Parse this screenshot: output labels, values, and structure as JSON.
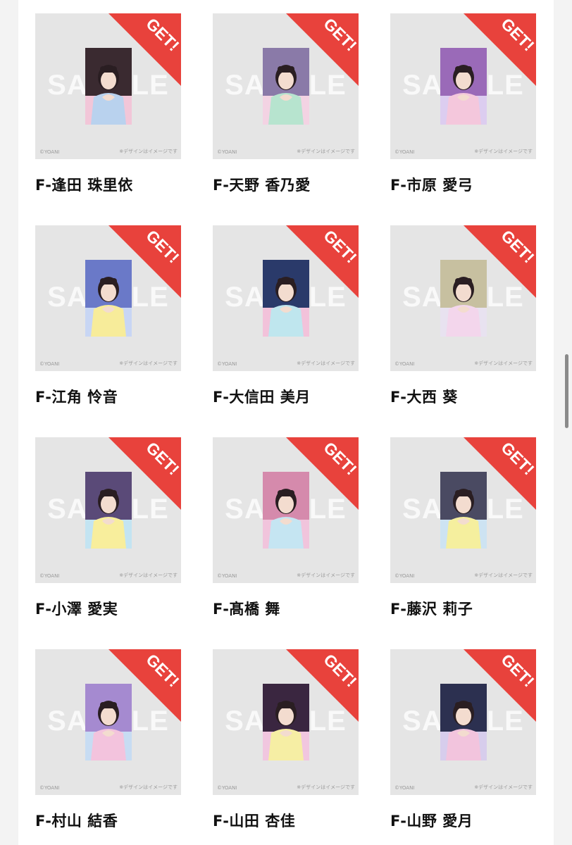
{
  "colors": {
    "ribbon": "#e8423c",
    "card_background": "#e5e5e5",
    "page_background": "#f3f3f3"
  },
  "cards": [
    {
      "name": "F-逢田 珠里依",
      "badge": "GET!",
      "watermark": "SAMPLE",
      "copyright": "©YOANI",
      "note": "※デザインはイメージです",
      "palette": [
        "#3a2a30",
        "#b9d2ee",
        "#f2c6d8"
      ]
    },
    {
      "name": "F-天野 香乃愛",
      "badge": "GET!",
      "watermark": "SAMPLE",
      "copyright": "©YOANI",
      "note": "※デザインはイメージです",
      "palette": [
        "#8a7aa8",
        "#b7e4cf",
        "#f3d3e3"
      ]
    },
    {
      "name": "F-市原 愛弓",
      "badge": "GET!",
      "watermark": "SAMPLE",
      "copyright": "©YOANI",
      "note": "※デザインはイメージです",
      "palette": [
        "#9a6ab8",
        "#f4c7dc",
        "#dccdf0"
      ]
    },
    {
      "name": "F-江角 怜音",
      "badge": "GET!",
      "watermark": "SAMPLE",
      "copyright": "©YOANI",
      "note": "※デザインはイメージです",
      "palette": [
        "#6a79c8",
        "#f7ec9a",
        "#c8d6f4"
      ]
    },
    {
      "name": "F-大信田 美月",
      "badge": "GET!",
      "watermark": "SAMPLE",
      "copyright": "©YOANI",
      "note": "※デザインはイメージです",
      "palette": [
        "#2a3a6a",
        "#bfe6ee",
        "#f2c2da"
      ]
    },
    {
      "name": "F-大西 葵",
      "badge": "GET!",
      "watermark": "SAMPLE",
      "copyright": "©YOANI",
      "note": "※デザインはイメージです",
      "palette": [
        "#c7c0a0",
        "#f3d6ec",
        "#e8e2f0"
      ]
    },
    {
      "name": "F-小澤 愛実",
      "badge": "GET!",
      "watermark": "SAMPLE",
      "copyright": "©YOANI",
      "note": "※デザインはイメージです",
      "palette": [
        "#5a4a78",
        "#f8ee9c",
        "#c3e4f2"
      ]
    },
    {
      "name": "F-髙橋 舞",
      "badge": "GET!",
      "watermark": "SAMPLE",
      "copyright": "©YOANI",
      "note": "※デザインはイメージです",
      "palette": [
        "#d58aac",
        "#c5e5f2",
        "#f1c4dc"
      ]
    },
    {
      "name": "F-藤沢 莉子",
      "badge": "GET!",
      "watermark": "SAMPLE",
      "copyright": "©YOANI",
      "note": "※デザインはイメージです",
      "palette": [
        "#4a4a62",
        "#f5ef9e",
        "#cde3f2"
      ]
    },
    {
      "name": "F-村山 結香",
      "badge": "GET!",
      "watermark": "SAMPLE",
      "copyright": "©YOANI",
      "note": "※デザインはイメージです",
      "palette": [
        "#a58ad0",
        "#f3c3dd",
        "#c7dcf3"
      ]
    },
    {
      "name": "F-山田 杏佳",
      "badge": "GET!",
      "watermark": "SAMPLE",
      "copyright": "©YOANI",
      "note": "※デザインはイメージです",
      "palette": [
        "#3a2640",
        "#f6eea4",
        "#f1c6df"
      ]
    },
    {
      "name": "F-山野 愛月",
      "badge": "GET!",
      "watermark": "SAMPLE",
      "copyright": "©YOANI",
      "note": "※デザインはイメージです",
      "palette": [
        "#2c3050",
        "#f2c4dd",
        "#d7cdec"
      ]
    }
  ]
}
